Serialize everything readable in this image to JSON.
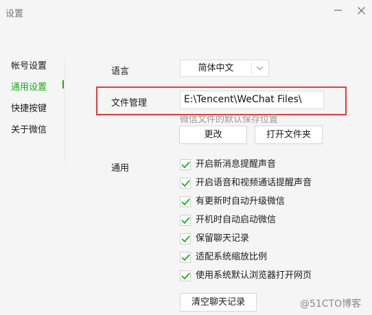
{
  "window": {
    "title": "设置"
  },
  "sidebar": {
    "items": [
      {
        "label": "帐号设置",
        "active": false
      },
      {
        "label": "通用设置",
        "active": true
      },
      {
        "label": "快捷按键",
        "active": false
      },
      {
        "label": "关于微信",
        "active": false
      }
    ],
    "accent": "#1aad19"
  },
  "language": {
    "label": "语言",
    "selected": "简体中文"
  },
  "file_management": {
    "label": "文件管理",
    "path": "E:\\Tencent\\WeChat Files\\",
    "hint": "微信文件的默认保存位置",
    "change_label": "更改",
    "open_folder_label": "打开文件夹",
    "highlight_color": "#e23a3a"
  },
  "general": {
    "label": "通用",
    "options": [
      {
        "label": "开启新消息提醒声音",
        "checked": true
      },
      {
        "label": "开启语音和视频通话提醒声音",
        "checked": true
      },
      {
        "label": "有更新时自动升级微信",
        "checked": true
      },
      {
        "label": "开机时自动启动微信",
        "checked": true
      },
      {
        "label": "保留聊天记录",
        "checked": true
      },
      {
        "label": "适配系统缩放比例",
        "checked": true
      },
      {
        "label": "使用系统默认浏览器打开网页",
        "checked": true
      }
    ],
    "clear_label": "清空聊天记录"
  },
  "watermark": "@51CTO博客"
}
